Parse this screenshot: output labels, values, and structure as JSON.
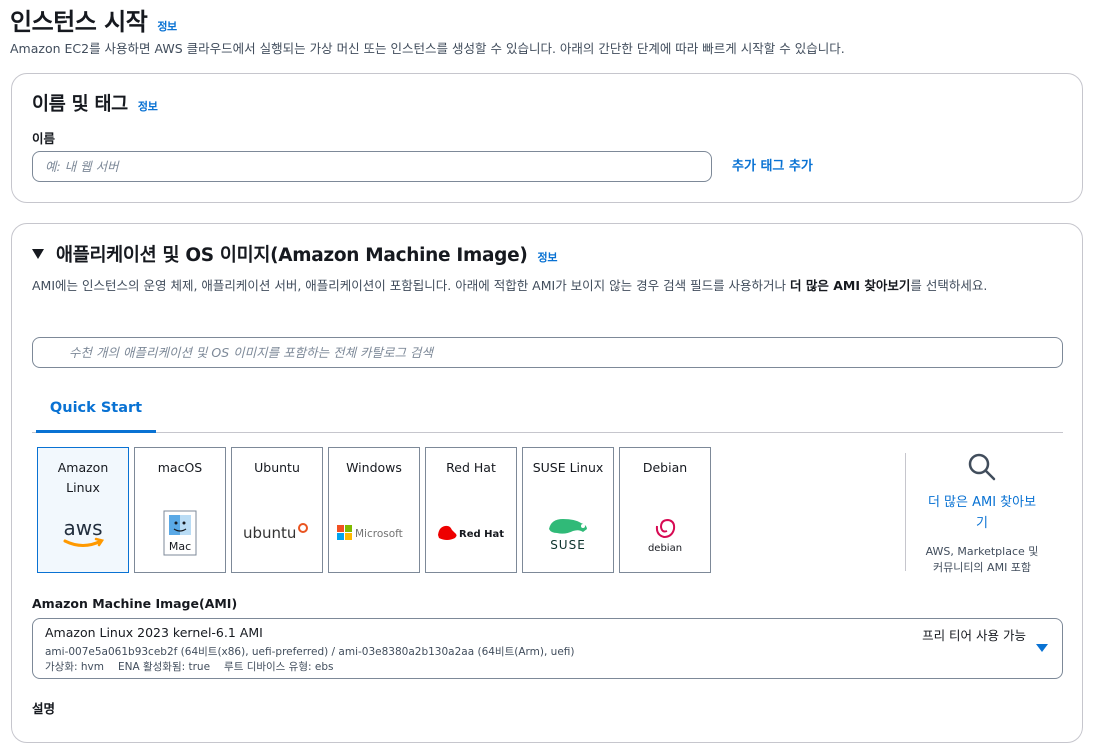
{
  "page": {
    "title": "인스턴스 시작",
    "info": "정보",
    "description": "Amazon EC2를 사용하면 AWS 클라우드에서 실행되는 가상 머신 또는 인스턴스를 생성할 수 있습니다. 아래의 간단한 단계에 따라 빠르게 시작할 수 있습니다."
  },
  "name_section": {
    "title": "이름 및 태그",
    "info": "정보",
    "name_label": "이름",
    "name_placeholder": "예: 내 웹 서버",
    "add_tags": "추가 태그 추가"
  },
  "ami_section": {
    "title": "애플리케이션 및 OS 이미지(Amazon Machine Image)",
    "info": "정보",
    "desc_part1": "AMI에는 인스턴스의 운영 체제, 애플리케이션 서버, 애플리케이션이 포함됩니다. 아래에 적합한 AMI가 보이지 않는 경우 검색 필드를 사용하거나 ",
    "desc_bold": "더 많은 AMI 찾아보기",
    "desc_part2": "를 선택하세요.",
    "search_placeholder": "수천 개의 애플리케이션 및 OS 이미지를 포함하는 전체 카탈로그 검색",
    "tab": "Quick Start",
    "os_options": [
      {
        "name": "Amazon Linux",
        "logo": "aws-logo",
        "selected": true
      },
      {
        "name": "macOS",
        "logo": "mac-logo",
        "selected": false
      },
      {
        "name": "Ubuntu",
        "logo": "ubuntu-logo",
        "selected": false
      },
      {
        "name": "Windows",
        "logo": "microsoft-logo",
        "selected": false
      },
      {
        "name": "Red Hat",
        "logo": "redhat-logo",
        "selected": false
      },
      {
        "name": "SUSE Linux",
        "logo": "suse-logo",
        "selected": false
      },
      {
        "name": "Debian",
        "logo": "debian-logo",
        "selected": false
      }
    ],
    "logo_text": {
      "aws": "aws",
      "mac": "Mac",
      "ubuntu": "ubuntu",
      "microsoft": "Microsoft",
      "redhat": "Red Hat",
      "suse": "SUSE",
      "debian": "debian"
    },
    "browse_more": {
      "label": "더 많은 AMI 찾아보기",
      "sub": "AWS, Marketplace 및 커뮤니티의 AMI 포함"
    },
    "ami_label": "Amazon Machine Image(AMI)",
    "selected_ami": {
      "name": "Amazon Linux 2023 kernel-6.1 AMI",
      "ids": "ami-007e5a061b93ceb2f (64비트(x86), uefi-preferred) / ami-03e8380a2b130a2aa (64비트(Arm), uefi)",
      "virtualization": "가상화: hvm",
      "ena": "ENA 활성화됨: true",
      "root_device": "루트 디바이스 유형: ebs",
      "free_tier": "프리 티어 사용 가능"
    },
    "next_label": "설명"
  },
  "colors": {
    "accent": "#0972d3",
    "border": "#c6c6cd",
    "text": "#16191f",
    "secondary_text": "#414d5c"
  }
}
